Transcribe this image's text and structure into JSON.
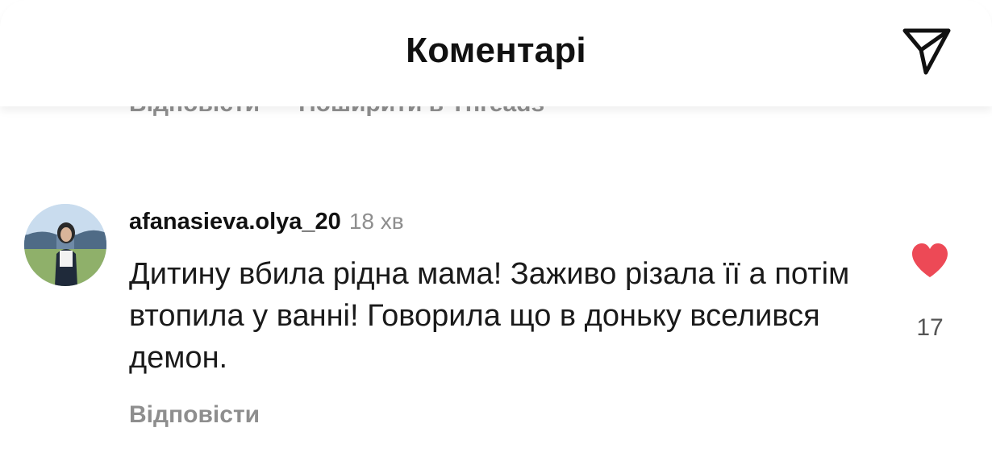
{
  "header": {
    "title": "Коментарі",
    "share_icon": "paper-plane-icon"
  },
  "previous_comment": {
    "reply_label": "Відповісти",
    "share_label": "Поширити в Threads"
  },
  "comment": {
    "username": "afanasieva.olya_20",
    "time": "18 хв",
    "text": "Дитину вбила рідна мама! Заживо різала її а потім втопила у ванні! Говорила що в доньку вселився демон.",
    "reply_label": "Відповісти",
    "likes": "17",
    "liked": true,
    "like_icon": "heart-icon",
    "like_color": "#ed4956"
  }
}
